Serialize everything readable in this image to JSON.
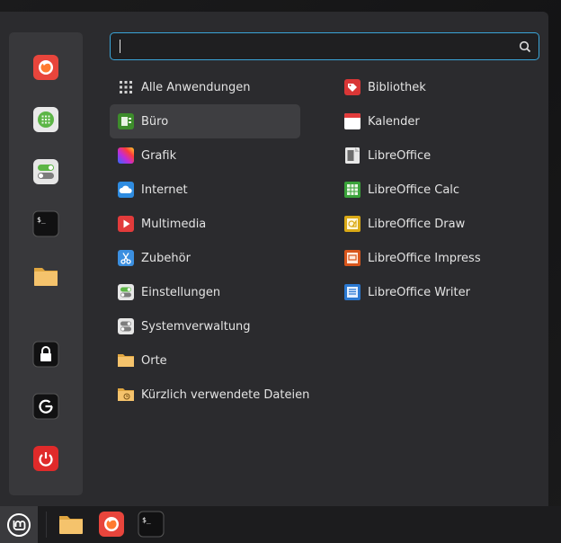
{
  "search": {
    "value": "",
    "placeholder": ""
  },
  "favorites": [
    {
      "name": "firefox-icon"
    },
    {
      "name": "software-manager-icon"
    },
    {
      "name": "settings-toggle-icon"
    },
    {
      "name": "terminal-icon"
    },
    {
      "name": "folder-icon"
    },
    {
      "name": "lock-icon"
    },
    {
      "name": "logout-icon"
    },
    {
      "name": "power-icon"
    }
  ],
  "categories": [
    {
      "label": "Alle Anwendungen",
      "icon": "grid-icon"
    },
    {
      "label": "Büro",
      "icon": "office-icon",
      "selected": true
    },
    {
      "label": "Grafik",
      "icon": "graphics-icon"
    },
    {
      "label": "Internet",
      "icon": "cloud-icon"
    },
    {
      "label": "Multimedia",
      "icon": "play-icon"
    },
    {
      "label": "Zubehör",
      "icon": "scissors-icon"
    },
    {
      "label": "Einstellungen",
      "icon": "toggle-icon"
    },
    {
      "label": "Systemverwaltung",
      "icon": "system-icon"
    },
    {
      "label": "Orte",
      "icon": "folder-icon"
    },
    {
      "label": "Kürzlich verwendete Dateien",
      "icon": "recent-folder-icon"
    }
  ],
  "apps": [
    {
      "label": "Bibliothek",
      "icon": "library-icon"
    },
    {
      "label": "Kalender",
      "icon": "calendar-icon"
    },
    {
      "label": "LibreOffice",
      "icon": "libreoffice-icon"
    },
    {
      "label": "LibreOffice Calc",
      "icon": "calc-icon"
    },
    {
      "label": "LibreOffice Draw",
      "icon": "draw-icon"
    },
    {
      "label": "LibreOffice Impress",
      "icon": "impress-icon"
    },
    {
      "label": "LibreOffice Writer",
      "icon": "writer-icon"
    }
  ],
  "taskbar": [
    {
      "name": "folder-icon"
    },
    {
      "name": "firefox-icon"
    },
    {
      "name": "terminal-icon"
    }
  ],
  "colors": {
    "accent": "#3aa5d8",
    "menu_bg": "#2b2b2e",
    "favorites_bg": "#38383b",
    "selected_row": "#3e3e41"
  }
}
